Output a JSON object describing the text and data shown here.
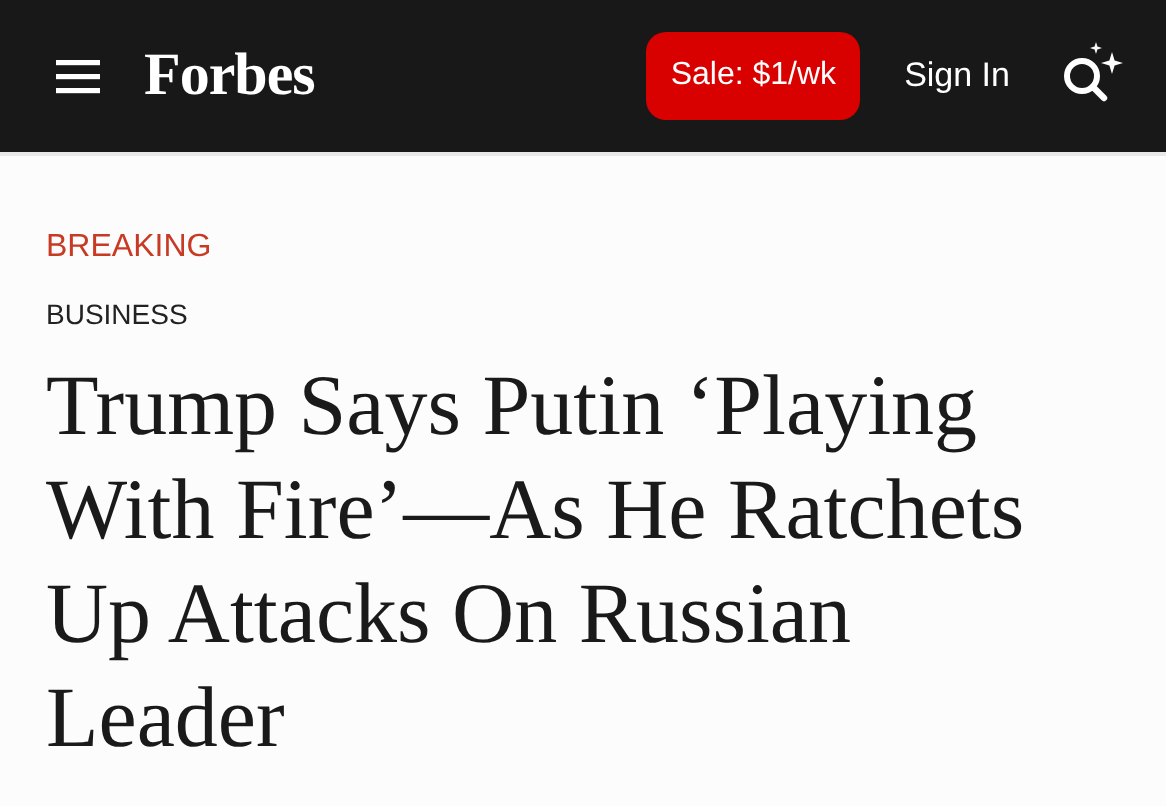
{
  "header": {
    "logo": "Forbes",
    "sale_button": "Sale: $1/wk",
    "sign_in": "Sign In"
  },
  "article": {
    "label": "BREAKING",
    "section": "BUSINESS",
    "headline": "Trump Says Putin ‘Playing With Fire’—As He Ratchets Up Attacks On Russian Leader"
  }
}
